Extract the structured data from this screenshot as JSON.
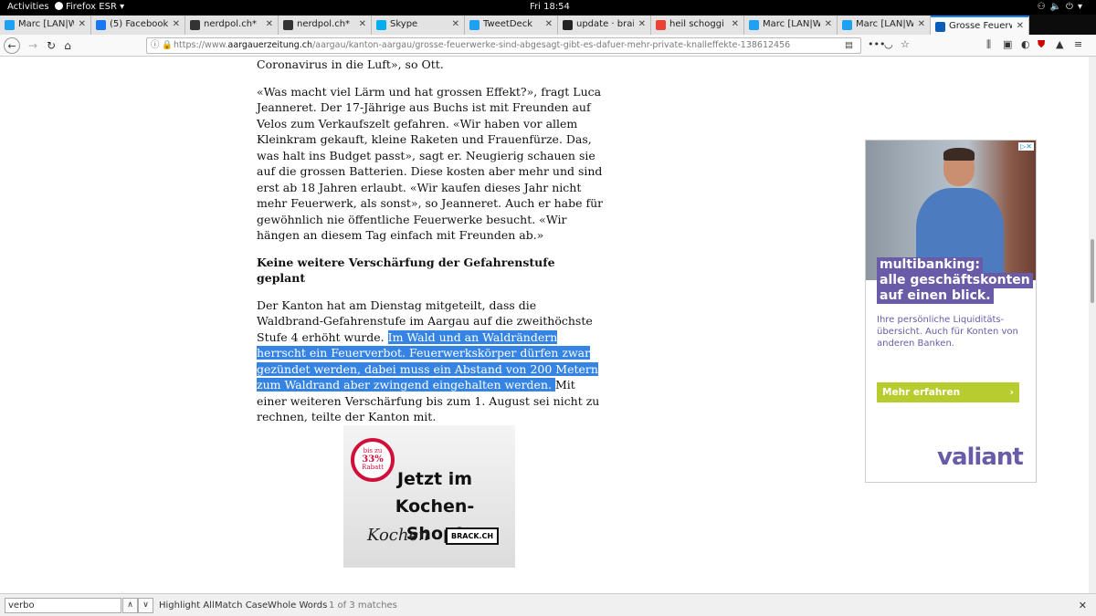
{
  "system": {
    "activities": "Activities",
    "app_name": "Firefox ESR",
    "clock": "Fri 18:54"
  },
  "tabs": [
    {
      "label": "Marc [LAN|WA",
      "icon": "twitter-icon",
      "color": "#1da1f2"
    },
    {
      "label": "(5) Facebook",
      "icon": "facebook-icon",
      "color": "#1877f2"
    },
    {
      "label": "nerdpol.ch*",
      "icon": "nerdpol-icon",
      "color": "#333333"
    },
    {
      "label": "nerdpol.ch*",
      "icon": "nerdpol-icon",
      "color": "#333333"
    },
    {
      "label": "Skype",
      "icon": "skype-icon",
      "color": "#00aff0"
    },
    {
      "label": "TweetDeck",
      "icon": "tweetdeck-icon",
      "color": "#1da1f2"
    },
    {
      "label": "update · braind",
      "icon": "github-icon",
      "color": "#222222"
    },
    {
      "label": "heil schoggi isl",
      "icon": "google-icon",
      "color": "#ea4335"
    },
    {
      "label": "Marc [LAN|WA",
      "icon": "twitter-icon",
      "color": "#1da1f2"
    },
    {
      "label": "Marc [LAN|WA",
      "icon": "twitter-icon",
      "color": "#1da1f2"
    },
    {
      "label": "Grosse Feuerw",
      "icon": "az-icon",
      "color": "#0a5db8",
      "active": true
    }
  ],
  "navbar": {
    "url_prefix": "https://www.",
    "url_domain": "aargauerzeitung.ch",
    "url_path": "/aargau/kanton-aargau/grosse-feuerwerke-sind-abgesagt-gibt-es-dafuer-mehr-private-knalleffekte-138612456"
  },
  "article": {
    "p0": "Coronavirus in die Luft», so Ott.",
    "p1": "«Was macht viel Lärm und hat grossen Effekt?», fragt Luca Jeanneret. Der 17-Jährige aus Buchs ist mit Freunden auf Velos zum Verkaufszelt gefahren. «Wir haben vor allem Kleinkram gekauft, kleine Raketen und Frauenfürze. Das, was halt ins Budget passt», sagt er. Neugierig schauen sie auf die grossen Batterien. Diese kosten aber mehr und sind erst ab 18 Jahren erlaubt. «Wir kaufen dieses Jahr nicht mehr Feuerwerk, als sonst», so Jeanneret. Auch er habe für gewöhnlich nie öffentliche Feuerwerke besucht. «Wir hängen an diesem Tag einfach mit Freunden ab.»",
    "heading": "Keine weitere Verschärfung der Gefahrenstufe geplant",
    "p2_before": "Der Kanton hat am Dienstag mitgeteilt, dass die Waldbrand-Gefahrenstufe im Aargau auf die zweithöchste Stufe 4 erhöht wurde. ",
    "p2_highlight": "Im Wald und an Waldrändern herrscht ein Feuerverbot. Feuerwerkskörper dürfen zwar gezündet werden, dabei muss ein Abstand von 200 Metern zum Waldrand aber zwingend eingehalten werden. ",
    "p2_after": "Mit einer weiteren Verschärfung bis zum 1. August sei nicht zu rechnen, teilte der Kanton mit."
  },
  "inline_ad": {
    "badge_top": "bis zu",
    "badge_value": "33%",
    "badge_bottom": "Rabatt",
    "title": "Jetzt im Kochen-Shop!",
    "script": "Kochen",
    "brand": "BRACK.CH"
  },
  "side_ad": {
    "adchoice": "▷✕",
    "headline_1": "multibanking:",
    "headline_2": "alle geschäftskonten",
    "headline_3": "auf einen blick.",
    "sub": "Ihre persönliche Liquiditäts-übersicht. Auch für Konten von anderen Banken.",
    "cta": "Mehr erfahren",
    "logo": "valiant"
  },
  "findbar": {
    "query": "verbo",
    "highlight_all": "Highlight All",
    "match_case": "Match Case",
    "whole_words": "Whole Words",
    "matches": "1 of 3 matches"
  }
}
